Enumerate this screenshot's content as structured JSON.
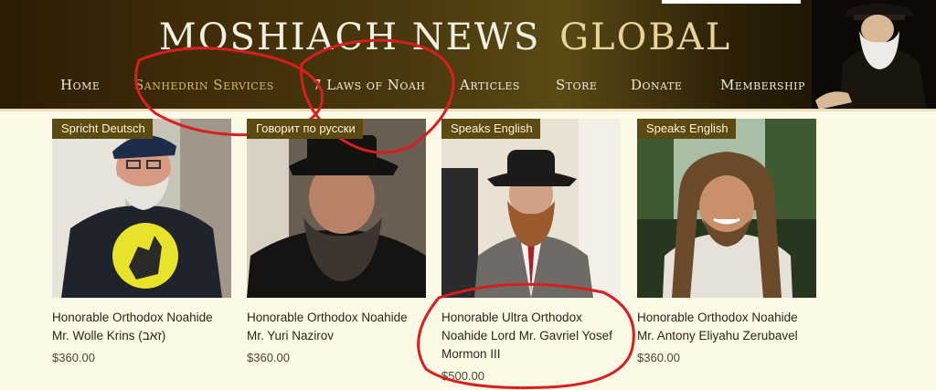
{
  "header": {
    "title_main": "MOSHIACH NEWS",
    "title_accent": "GLOBAL"
  },
  "nav": {
    "items": [
      {
        "label": "Home"
      },
      {
        "label": "Sanhedrin Services"
      },
      {
        "label": "7 Laws of Noah"
      },
      {
        "label": "Articles"
      },
      {
        "label": "Store"
      },
      {
        "label": "Donate"
      },
      {
        "label": "Membership"
      }
    ]
  },
  "products": [
    {
      "badge": "Spricht Deutsch",
      "name_line1": "Honorable Orthodox Noahide",
      "name_line2": "Mr. Wolle Krins (זאב)",
      "name_line3": "",
      "price": "$360.00"
    },
    {
      "badge": "Говорит по русски",
      "name_line1": "Honorable Orthodox Noahide",
      "name_line2": "Mr. Yuri Nazirov",
      "name_line3": "",
      "price": "$360.00"
    },
    {
      "badge": "Speaks English",
      "name_line1": "Honorable Ultra Orthodox",
      "name_line2": "Noahide Lord Mr. Gavriel Yosef",
      "name_line3": "Mormon III",
      "price": "$500.00"
    },
    {
      "badge": "Speaks English",
      "name_line1": "Honorable Orthodox Noahide",
      "name_line2": "Mr. Antony Eliyahu Zerubavel",
      "name_line3": "",
      "price": "$360.00"
    }
  ],
  "colors": {
    "badge_bg": "#5b4a14",
    "annotation_red": "#d81e1e",
    "page_bg": "#fdf9e7"
  }
}
